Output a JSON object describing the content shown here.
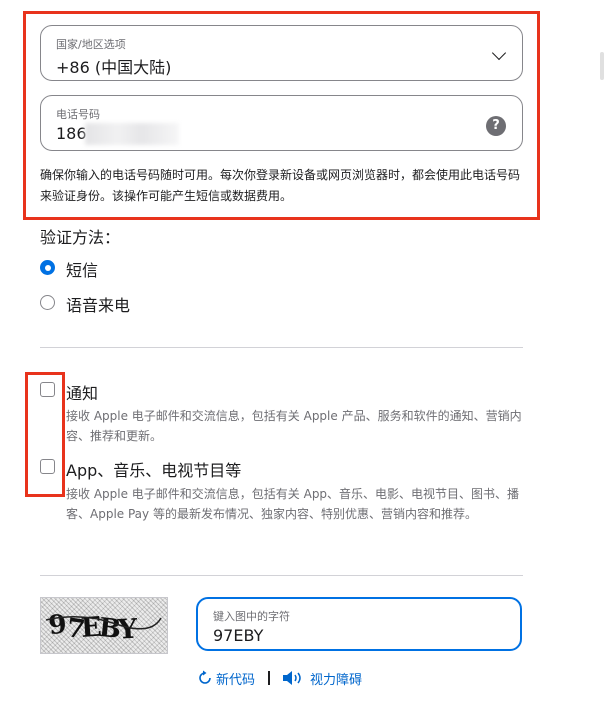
{
  "phone": {
    "country_label": "国家/地区选项",
    "country_value": "+86 (中国大陆)",
    "phone_label": "电话号码",
    "phone_value_prefix": "186",
    "help_glyph": "?",
    "note": "确保你输入的电话号码随时可用。每次你登录新设备或网页浏览器时，都会使用此电话号码来验证身份。该操作可能产生短信或数据费用。"
  },
  "verify": {
    "title": "验证方法：",
    "options": [
      {
        "label": "短信",
        "selected": true
      },
      {
        "label": "语音来电",
        "selected": false
      }
    ]
  },
  "subscriptions": [
    {
      "title": "通知",
      "description": "接收 Apple 电子邮件和交流信息，包括有关 Apple 产品、服务和软件的通知、营销内容、推荐和更新。",
      "checked": false
    },
    {
      "title": "App、音乐、电视节目等",
      "description": "接收 Apple 电子邮件和交流信息，包括有关 App、音乐、电影、电视节目、图书、播客、Apple Pay 等的最新发布情况、独家内容、特别优惠、营销内容和推荐。",
      "checked": false
    }
  ],
  "captcha": {
    "image_text": "97EBY",
    "input_label": "键入图中的字符",
    "input_value": "97EBY",
    "new_code_label": "新代码",
    "accessibility_label": "视力障碍"
  },
  "colors": {
    "accent": "#0071e3",
    "link": "#0066cc",
    "highlight_border": "#e8331c"
  }
}
